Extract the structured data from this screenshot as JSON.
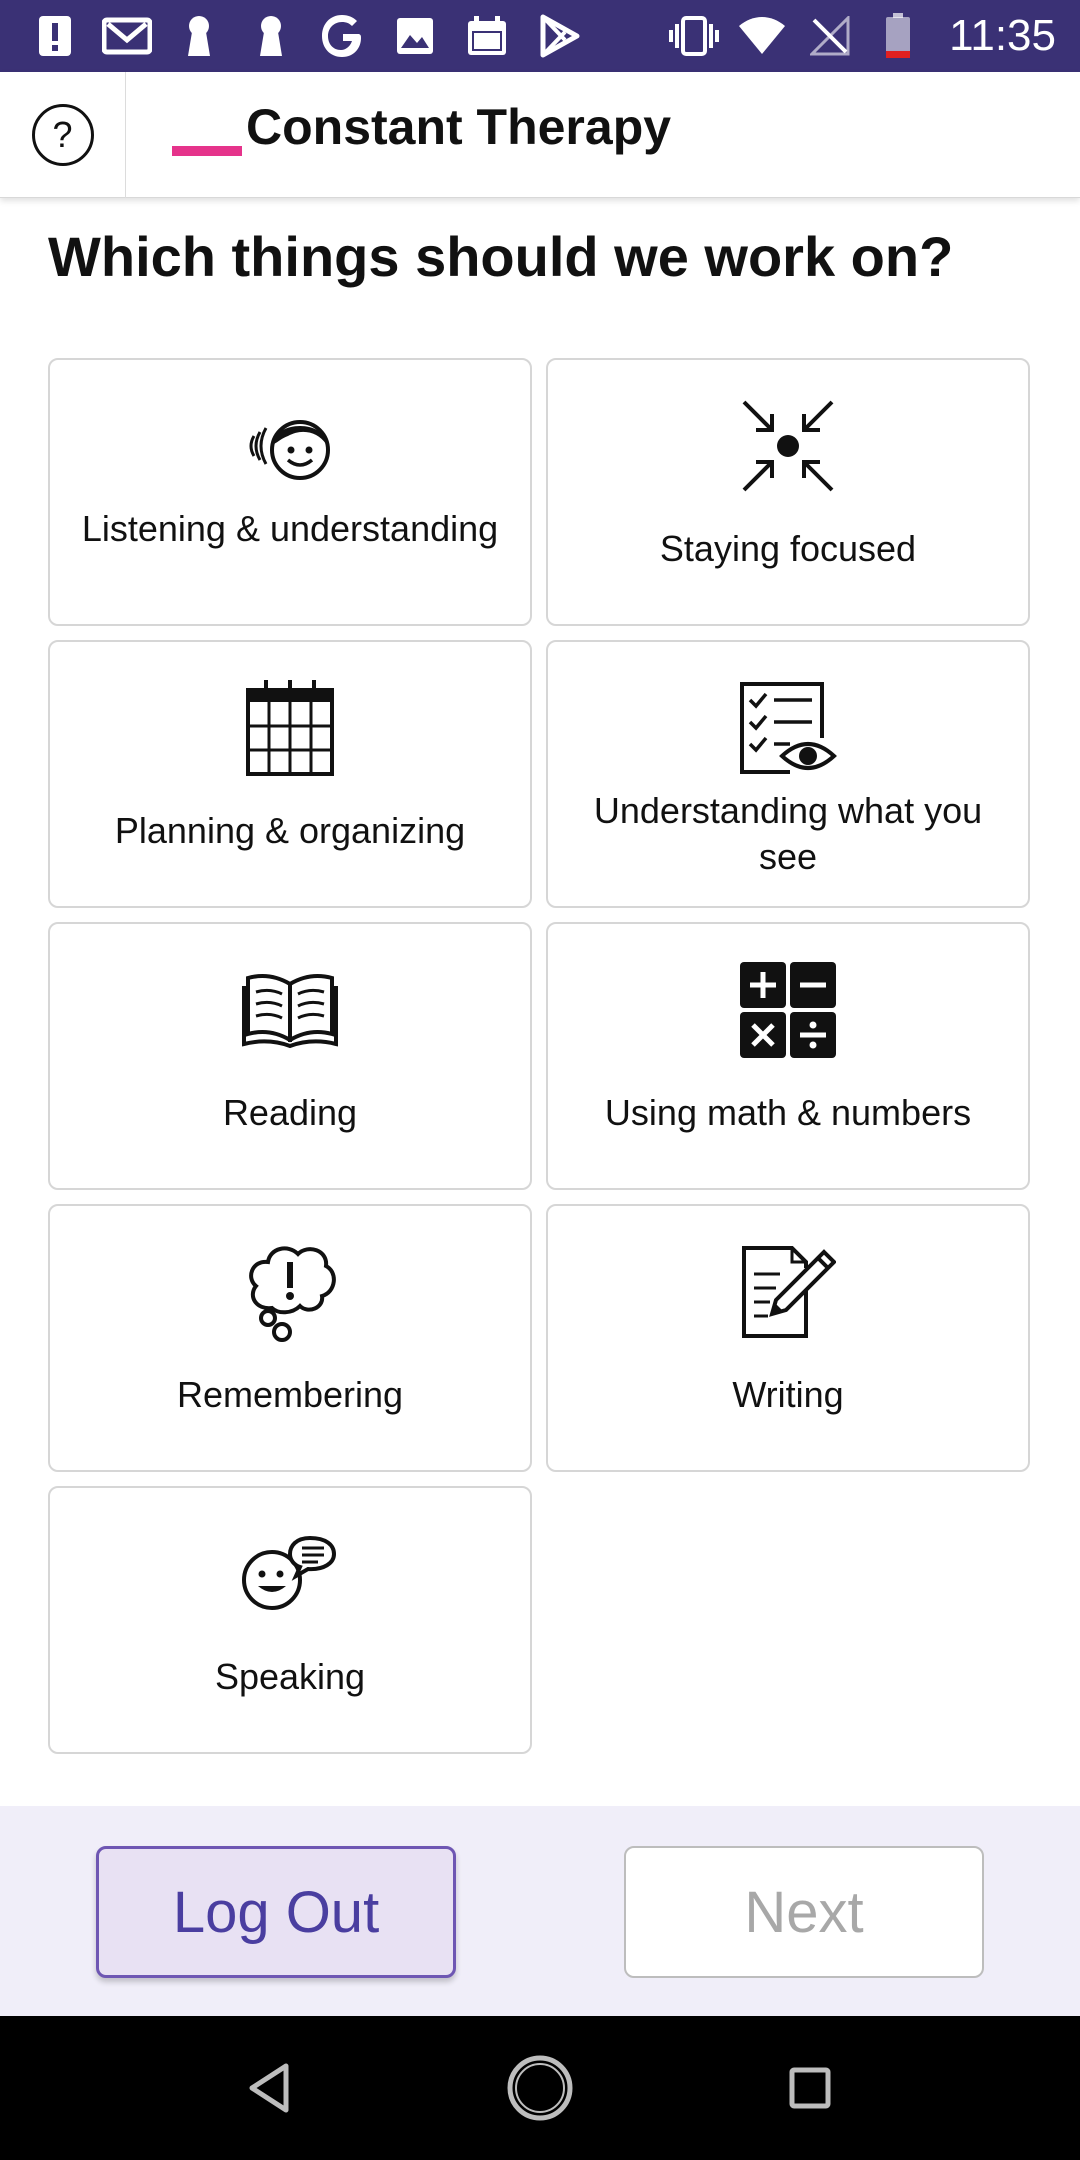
{
  "status_bar": {
    "time": "11:35",
    "left_icons": [
      "alert-icon",
      "mail-icon",
      "keyhole-icon",
      "keyhole-icon",
      "google-icon",
      "image-icon",
      "calendar-icon",
      "play-store-icon"
    ],
    "right_icons": [
      "vibrate-icon",
      "wifi-icon",
      "no-signal-icon",
      "battery-low-icon"
    ],
    "background": "#3a3175"
  },
  "app_bar": {
    "help_label": "?",
    "app_title": "Constant Therapy",
    "accent_color": "#e5338b"
  },
  "main": {
    "heading": "Which things should we work on?",
    "options": [
      {
        "label": "Listening & understanding",
        "icon": "listening-face-icon"
      },
      {
        "label": "Staying focused",
        "icon": "focus-arrows-icon"
      },
      {
        "label": "Planning & organizing",
        "icon": "calendar-grid-icon"
      },
      {
        "label": "Understanding what you see",
        "icon": "checklist-eye-icon"
      },
      {
        "label": "Reading",
        "icon": "open-book-icon"
      },
      {
        "label": "Using math & numbers",
        "icon": "math-operators-icon"
      },
      {
        "label": "Remembering",
        "icon": "thought-bubble-icon"
      },
      {
        "label": "Writing",
        "icon": "paper-pencil-icon"
      },
      {
        "label": "Speaking",
        "icon": "speaking-face-icon"
      }
    ]
  },
  "footer": {
    "logout_label": "Log Out",
    "next_label": "Next"
  },
  "nav_bar": {
    "buttons": [
      "back-icon",
      "home-icon",
      "recents-icon"
    ]
  }
}
